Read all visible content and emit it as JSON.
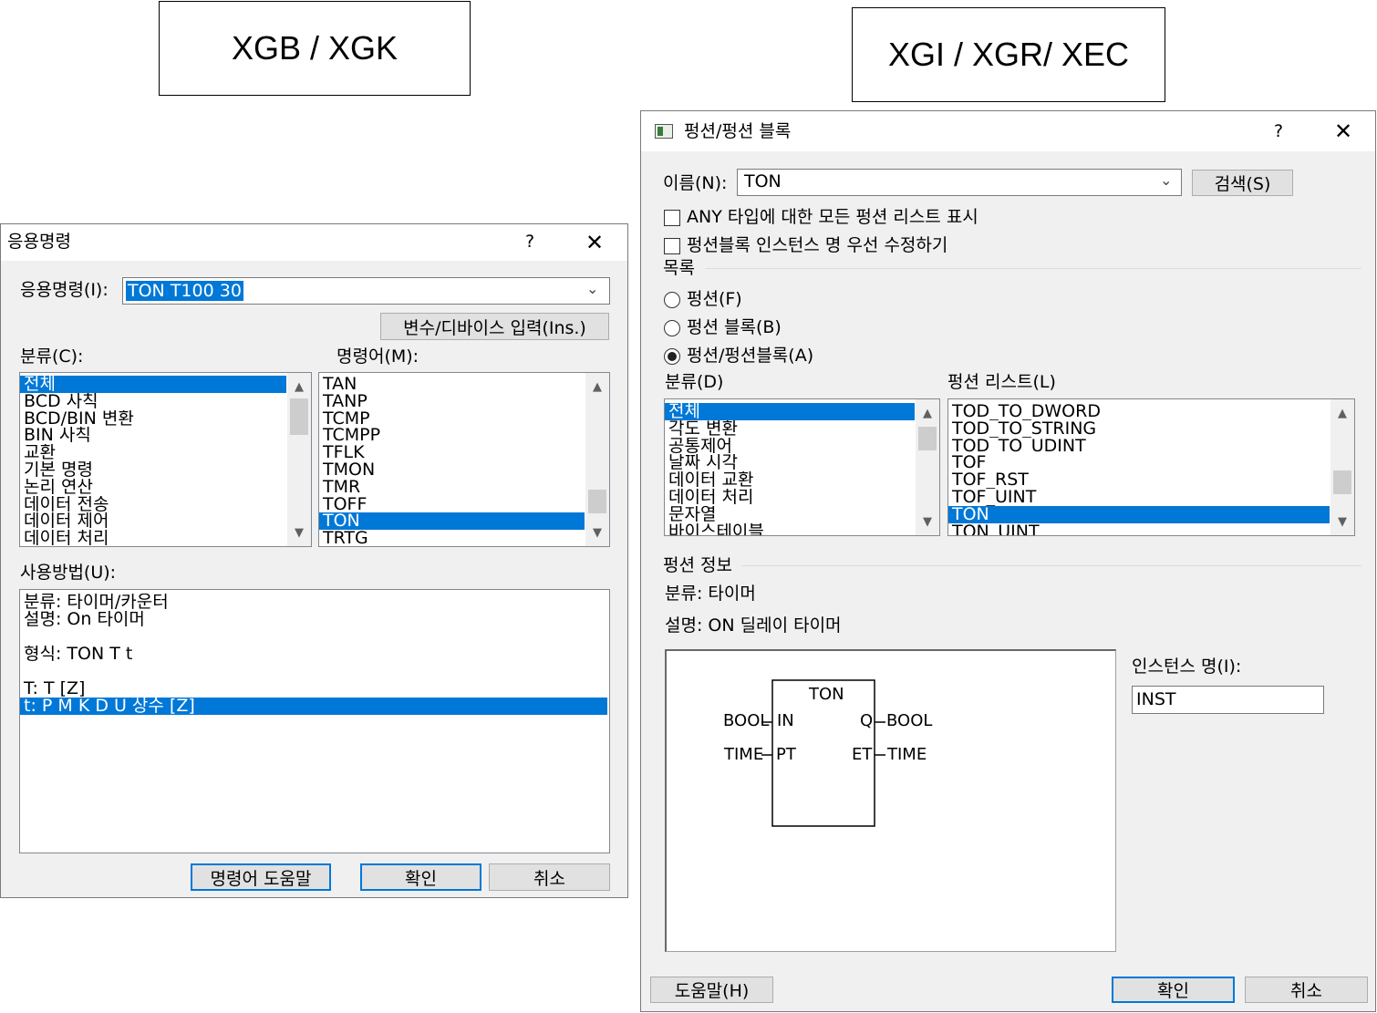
{
  "captions": {
    "left": "XGB / XGK",
    "right": "XGI / XGR/ XEC"
  },
  "left_dialog": {
    "title": "응용명령",
    "help_glyph": "?",
    "close_glyph": "✕",
    "command_label": "응용명령(I):",
    "command_value": "TON T100 30",
    "device_button": "변수/디바이스 입력(Ins.)",
    "category_label": "분류(C):",
    "categories": [
      {
        "label": "전체",
        "selected": true
      },
      {
        "label": "BCD 사칙"
      },
      {
        "label": "BCD/BIN 변환"
      },
      {
        "label": "BIN 사칙"
      },
      {
        "label": "교환"
      },
      {
        "label": "기본 명령"
      },
      {
        "label": "논리 연산"
      },
      {
        "label": "데이터 전송"
      },
      {
        "label": "데이터 제어"
      },
      {
        "label": "데이터 처리"
      }
    ],
    "instruction_label": "명령어(M):",
    "instructions": [
      {
        "label": "TAN"
      },
      {
        "label": "TANP"
      },
      {
        "label": "TCMP"
      },
      {
        "label": "TCMPP"
      },
      {
        "label": "TFLK"
      },
      {
        "label": "TMON"
      },
      {
        "label": "TMR"
      },
      {
        "label": "TOFF"
      },
      {
        "label": "TON",
        "selected": true
      },
      {
        "label": "TRTG"
      }
    ],
    "usage_label": "사용방법(U):",
    "usage_lines": [
      {
        "text": "분류: 타이머/카운터"
      },
      {
        "text": "설명: On 타이머"
      },
      {
        "text": ""
      },
      {
        "text": "형식: TON T t"
      },
      {
        "text": ""
      },
      {
        "text": "T:  T [Z]"
      },
      {
        "text": "t:  P M K D U 상수 [Z]",
        "selected": true
      }
    ],
    "buttons": {
      "help": "명령어 도움말",
      "ok": "확인",
      "cancel": "취소"
    }
  },
  "right_dialog": {
    "title": "펑션/펑션 블록",
    "help_glyph": "?",
    "close_glyph": "✕",
    "name_label": "이름(N):",
    "name_value": "TON",
    "search_button": "검색(S)",
    "check_any": "ANY 타입에 대한 모든 펑션 리스트 표시",
    "check_instance": "펑션블록 인스턴스 명 우선 수정하기",
    "list_group_label": "목록",
    "radio_function": "펑션(F)",
    "radio_block": "펑션 블록(B)",
    "radio_both": "펑션/펑션블록(A)",
    "category_label": "분류(D)",
    "categories": [
      {
        "label": "전체",
        "selected": true
      },
      {
        "label": "각도 변환"
      },
      {
        "label": "공통제어"
      },
      {
        "label": "날짜 시각"
      },
      {
        "label": "데이터 교환"
      },
      {
        "label": "데이터 처리"
      },
      {
        "label": "문자열"
      },
      {
        "label": "바이스테이블"
      }
    ],
    "function_list_label": "펑션 리스트(L)",
    "functions": [
      {
        "label": "TOD_TO_DWORD"
      },
      {
        "label": "TOD_TO_STRING"
      },
      {
        "label": "TOD_TO_UDINT"
      },
      {
        "label": "TOF"
      },
      {
        "label": "TOF_RST"
      },
      {
        "label": "TOF_UINT"
      },
      {
        "label": "TON",
        "selected": true
      },
      {
        "label": "TON_UINT"
      }
    ],
    "info_group_label": "펑션 정보",
    "info_category": "분류:  타이머",
    "info_description": "설명:  ON 딜레이 타이머",
    "block": {
      "name": "TON",
      "in1_type": "BOOL",
      "in1_pin": "IN",
      "in2_type": "TIME",
      "in2_pin": "PT",
      "out1_pin": "Q",
      "out1_type": "BOOL",
      "out2_pin": "ET",
      "out2_type": "TIME"
    },
    "instance_label": "인스턴스 명(I):",
    "instance_value": "INST",
    "buttons": {
      "help": "도움말(H)",
      "ok": "확인",
      "cancel": "취소"
    }
  }
}
